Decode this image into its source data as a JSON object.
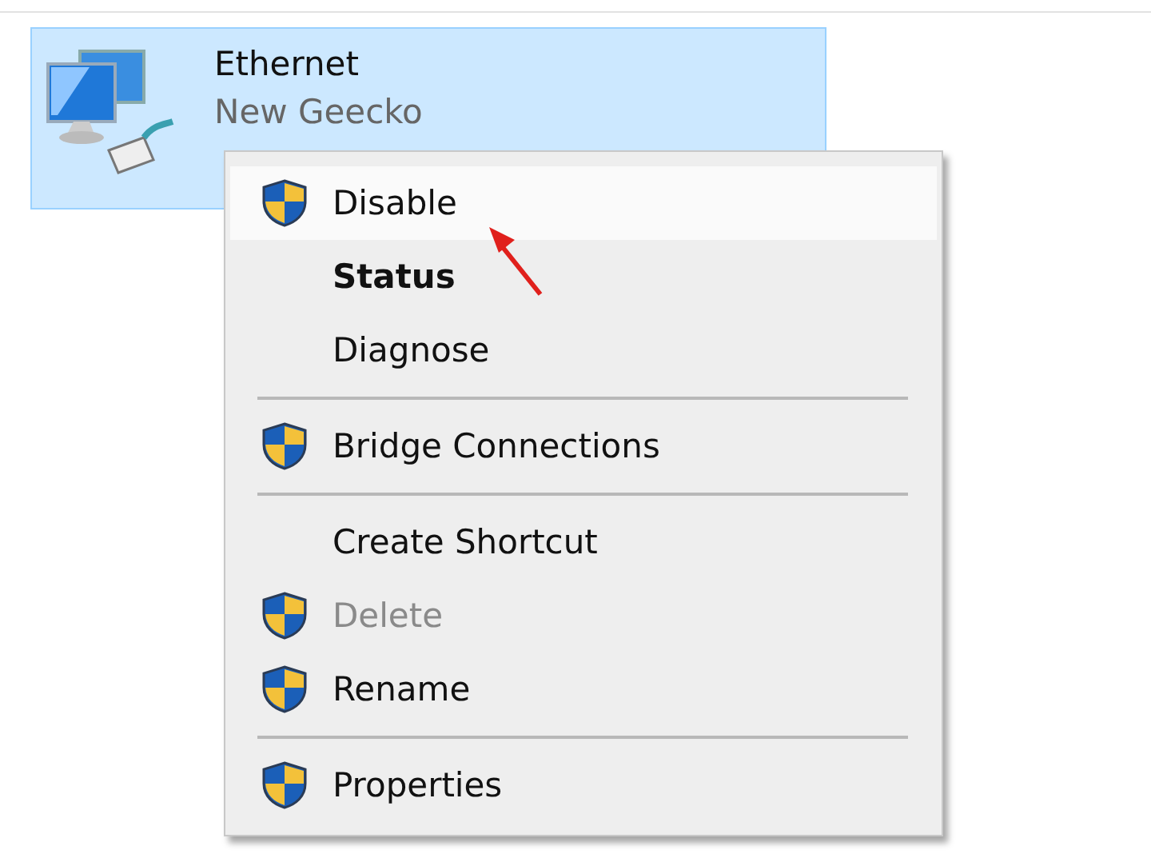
{
  "adapter": {
    "name": "Ethernet",
    "network": "New Geecko",
    "selected": true
  },
  "context_menu": {
    "items": [
      {
        "kind": "item",
        "label": "Disable",
        "shield": true,
        "default": false,
        "disabled": false,
        "selected": true
      },
      {
        "kind": "item",
        "label": "Status",
        "shield": false,
        "default": true,
        "disabled": false,
        "selected": false
      },
      {
        "kind": "item",
        "label": "Diagnose",
        "shield": false,
        "default": false,
        "disabled": false,
        "selected": false
      },
      {
        "kind": "separator"
      },
      {
        "kind": "item",
        "label": "Bridge Connections",
        "shield": true,
        "default": false,
        "disabled": false,
        "selected": false
      },
      {
        "kind": "separator"
      },
      {
        "kind": "item",
        "label": "Create Shortcut",
        "shield": false,
        "default": false,
        "disabled": false,
        "selected": false
      },
      {
        "kind": "item",
        "label": "Delete",
        "shield": true,
        "default": false,
        "disabled": true,
        "selected": false
      },
      {
        "kind": "item",
        "label": "Rename",
        "shield": true,
        "default": false,
        "disabled": false,
        "selected": false
      },
      {
        "kind": "separator"
      },
      {
        "kind": "item",
        "label": "Properties",
        "shield": true,
        "default": false,
        "disabled": false,
        "selected": false
      }
    ]
  }
}
